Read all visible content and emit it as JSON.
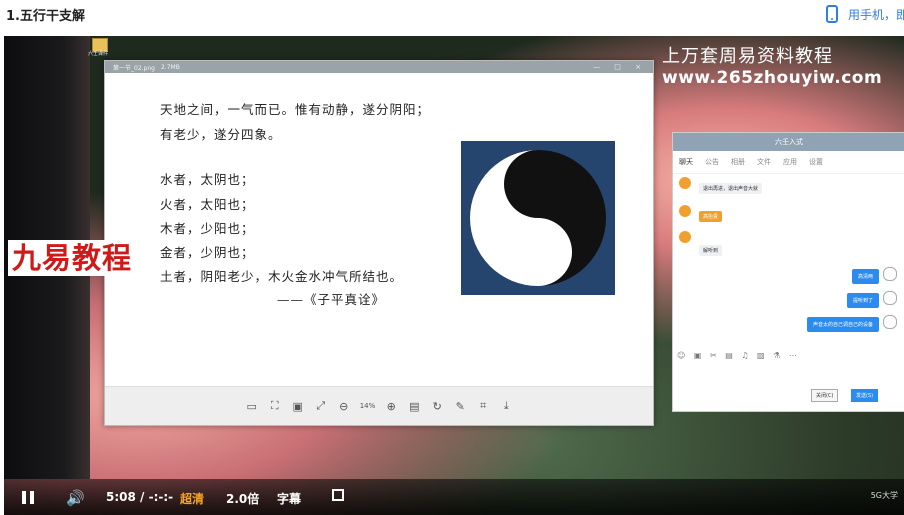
{
  "page": {
    "title": "1.五行干支解",
    "phone_link": "用手机，即"
  },
  "desktop": {
    "icon_label": "六壬课件"
  },
  "banner": {
    "site_cn": "上万套周易资料教程",
    "site_url": "www.265zhouyiw.com"
  },
  "viewer": {
    "filename": "第一节_02.png",
    "size": "2.7MB",
    "window_controls": "— □ ×",
    "lines": [
      "天地之间，一气而已。惟有动静，遂分阴阳；",
      "有老少，遂分四象。",
      "水者，太阴也；",
      "火者，太阳也；",
      "木者，少阳也；",
      "金者，少阴也；",
      "土者，阴阳老少，木火金水冲气所结也。",
      "——《子平真诠》"
    ],
    "zoom": "14%"
  },
  "watermark": "九易教程",
  "chat": {
    "title": "六壬入式",
    "tabs": [
      "聊天",
      "公告",
      "相册",
      "文件",
      "应用",
      "设置"
    ],
    "left_messages": [
      "退出再进，退出声音大就",
      "高抬贵",
      "解听到"
    ],
    "right_messages": [
      "高清两",
      "提听到了",
      "声音太的自己调自己的设备"
    ],
    "toolbar": "☺ ▣ ✂ ▤ ♫ ▧ ⚗ ⋯",
    "close_label": "关闭(C)",
    "send_label": "发送(S)"
  },
  "player": {
    "time": "5:08 / -:-:-",
    "quality": "超清",
    "speed": "2.0倍",
    "subtitle": "字幕",
    "logo": "5G大学"
  }
}
